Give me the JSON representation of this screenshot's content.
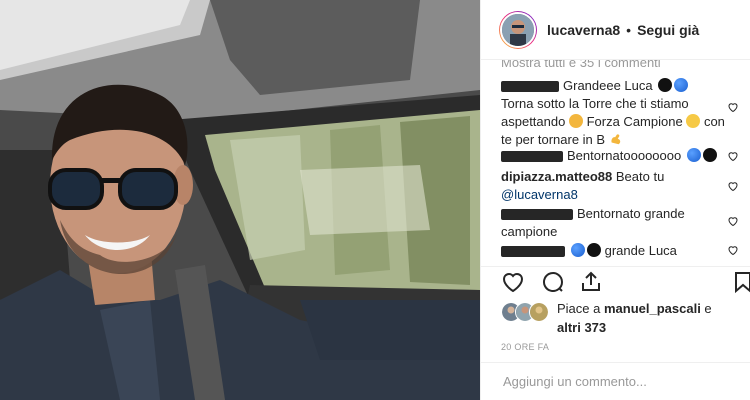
{
  "post": {
    "photo_description": "",
    "header": {
      "username": "lucaverna8",
      "separator": "•",
      "follow_label": "Segui già"
    },
    "load_more_text": "Mostra tutti e 35 i commenti",
    "comments": [
      {
        "text": "Grandeee Luca",
        "emojis": [
          "black-circle",
          "blue-circle"
        ]
      },
      {
        "text": "Torna sotto la Torre che ti stiamo aspettando",
        "text2": "Forza Campione",
        "text3": "con te per tornare in B",
        "emojis": [
          "cat-face",
          "smiling-face",
          "flexed-biceps"
        ]
      },
      {
        "text": "Bentornatoooooooo",
        "emojis": [
          "blue-circle",
          "black-circle"
        ]
      },
      {
        "handle": "dipiazza.matteo88",
        "text": "Beato tu",
        "mention": "@lucaverna8"
      },
      {
        "text": "Bentornato grande campione"
      },
      {
        "text": "grande Luca",
        "emojis": [
          "blue-circle",
          "black-circle"
        ]
      }
    ],
    "actions": {
      "like_icon": "heart-icon",
      "comment_icon": "comment-icon",
      "share_icon": "share-icon",
      "save_icon": "bookmark-icon"
    },
    "likes": {
      "prefix": "Piace a ",
      "user": "manuel_pascali",
      "suffix": " e",
      "others": "altri 373"
    },
    "time_ago": "20 ORE FA",
    "add_comment_placeholder": "Aggiungi un commento..."
  }
}
